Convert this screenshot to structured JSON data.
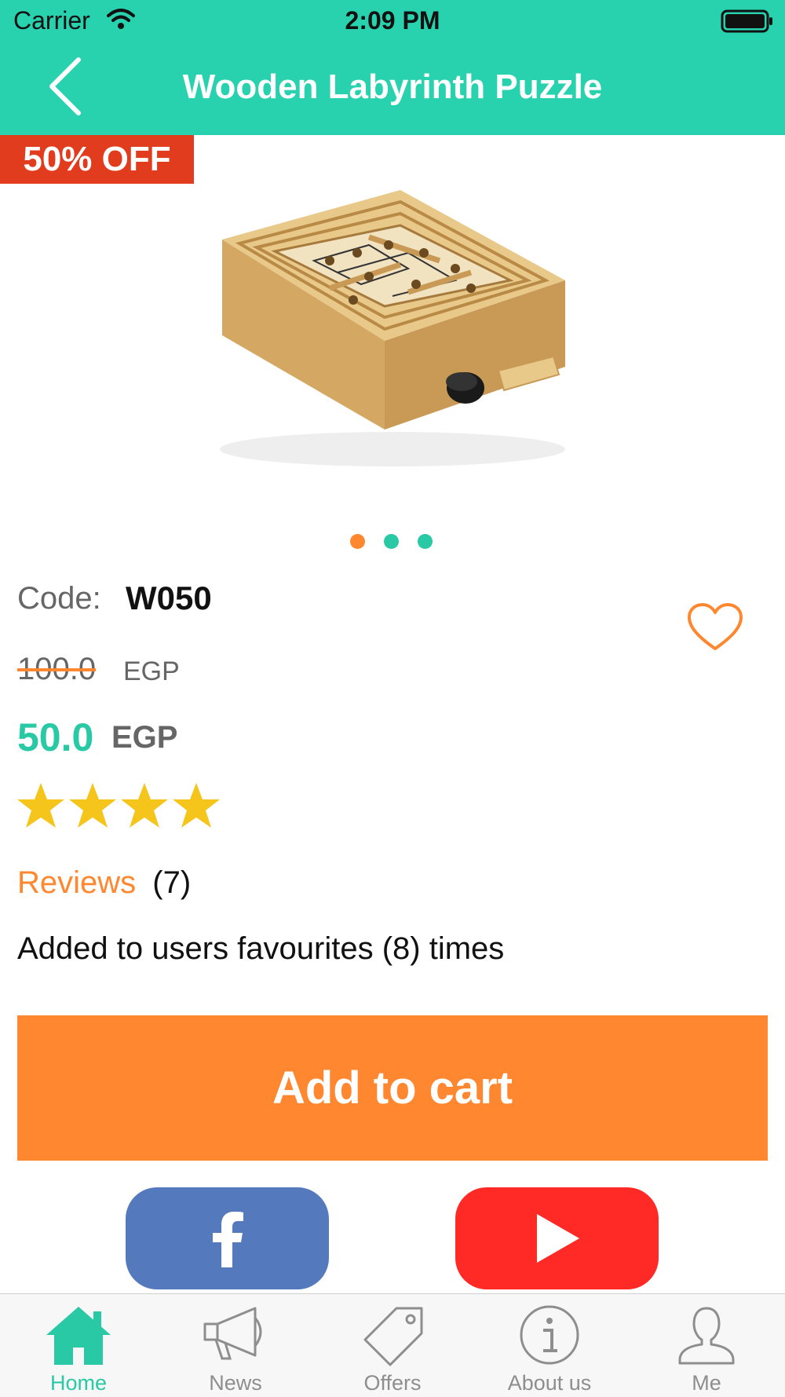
{
  "status_bar": {
    "carrier": "Carrier",
    "time": "2:09 PM"
  },
  "header": {
    "title": "Wooden Labyrinth Puzzle"
  },
  "product": {
    "badge": "50% OFF",
    "code_label": "Code:",
    "code": "W050",
    "old_price": "100.0",
    "old_currency": "EGP",
    "price": "50.0",
    "currency": "EGP",
    "rating": 4,
    "reviews_label": "Reviews",
    "reviews_count": "(7)",
    "favourites_text": "Added to users favourites (8) times",
    "gallery": {
      "total": 3,
      "active_index": 0
    }
  },
  "actions": {
    "add_to_cart": "Add to cart"
  },
  "social": [
    {
      "name": "facebook-icon",
      "color": "#5479bd"
    },
    {
      "name": "youtube-icon",
      "color": "#ff2a26"
    }
  ],
  "tab_bar": {
    "items": [
      {
        "label": "Home",
        "icon": "home-icon",
        "active": true
      },
      {
        "label": "News",
        "icon": "megaphone-icon",
        "active": false
      },
      {
        "label": "Offers",
        "icon": "tag-icon",
        "active": false
      },
      {
        "label": "About us",
        "icon": "info-icon",
        "active": false
      },
      {
        "label": "Me",
        "icon": "person-icon",
        "active": false
      }
    ]
  },
  "colors": {
    "header": "#28d2ae",
    "accent": "#ff8730",
    "price": "#28c9a4",
    "badge": "#e23c1e",
    "star": "#f5c51c"
  }
}
